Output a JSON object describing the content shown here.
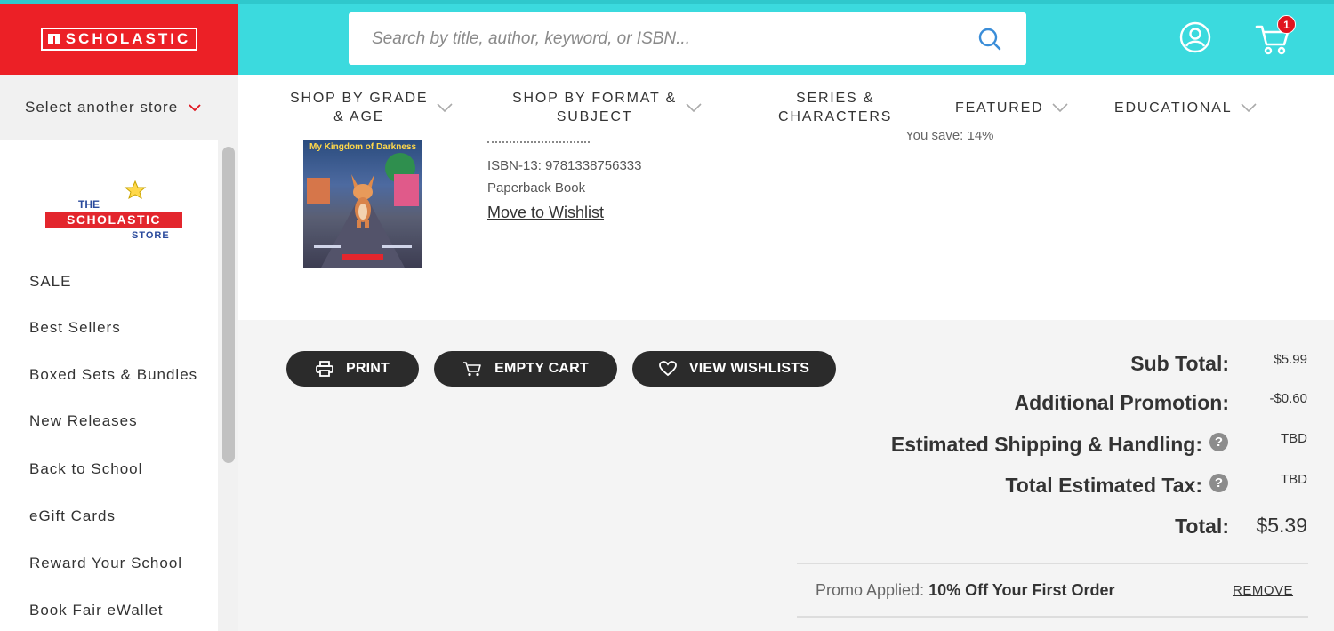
{
  "header": {
    "brand": "SCHOLASTIC",
    "search_placeholder": "Search by title, author, keyword, or ISBN...",
    "cart_count": "1",
    "colors": {
      "topbar": "#3bdade",
      "brand": "#ec2026"
    },
    "icons": {
      "search": "search-icon",
      "account": "account-icon",
      "cart": "cart-icon"
    }
  },
  "nav": {
    "store_select": "Select another store",
    "items": [
      {
        "line1": "SHOP BY GRADE",
        "line2": "& AGE",
        "has_chevron": true
      },
      {
        "line1": "SHOP BY FORMAT &",
        "line2": "SUBJECT",
        "has_chevron": true
      },
      {
        "line1": "SERIES &",
        "line2": "CHARACTERS",
        "has_chevron": false
      },
      {
        "line1": "FEATURED",
        "line2": "",
        "has_chevron": true
      },
      {
        "line1": "EDUCATIONAL",
        "line2": "",
        "has_chevron": true
      }
    ]
  },
  "sidebar": {
    "store_logo": {
      "line1": "THE",
      "line2": "SCHOLASTIC",
      "line3": "STORE"
    },
    "items": [
      "SALE",
      "Best Sellers",
      "Boxed Sets & Bundles",
      "New Releases",
      "Back to School",
      "eGift Cards",
      "Reward Your School",
      "Book Fair eWallet"
    ]
  },
  "product": {
    "cover_title": "My Kingdom of Darkness",
    "isbn": "ISBN-13: 9781338756333",
    "format": "Paperback Book",
    "wishlist_link": "Move to Wishlist",
    "you_save": "You save: 14%"
  },
  "actions": {
    "print": "PRINT",
    "empty_cart": "EMPTY CART",
    "view_wishlists": "VIEW WISHLISTS"
  },
  "summary": {
    "subtotal_label": "Sub Total:",
    "subtotal_value": "$5.99",
    "promotion_label": "Additional Promotion:",
    "promotion_value": "-$0.60",
    "shipping_label": "Estimated Shipping & Handling:",
    "shipping_value": "TBD",
    "tax_label": "Total Estimated Tax:",
    "tax_value": "TBD",
    "total_label": "Total:",
    "total_value": "$5.39",
    "help_glyph": "?"
  },
  "promo": {
    "prefix": "Promo Applied:",
    "name": "10% Off Your First Order",
    "remove": "REMOVE"
  }
}
